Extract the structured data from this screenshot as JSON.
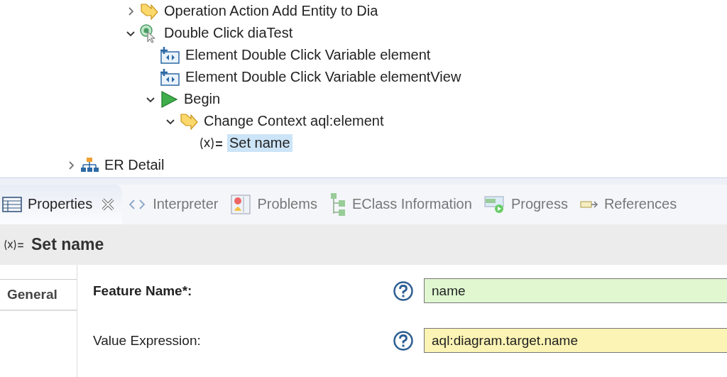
{
  "tree": {
    "items": [
      {
        "label": "Operation Action Add Entity to Dia",
        "kind": "operation",
        "expanded": false
      },
      {
        "label": "Double Click diaTest",
        "kind": "double-click",
        "expanded": true,
        "children": [
          {
            "label": "Element Double Click Variable element",
            "kind": "variable"
          },
          {
            "label": "Element Double Click Variable elementView",
            "kind": "variable"
          },
          {
            "label": "Begin",
            "kind": "begin",
            "expanded": true,
            "children": [
              {
                "label": "Change Context aql:element",
                "kind": "change-context",
                "expanded": true,
                "children": [
                  {
                    "label": "Set name",
                    "kind": "set",
                    "selected": true
                  }
                ]
              }
            ]
          }
        ]
      }
    ],
    "outer_items": [
      {
        "label": "ER Detail",
        "kind": "diagram",
        "expanded": false
      }
    ]
  },
  "tabs": [
    {
      "label": "Properties",
      "kind": "properties",
      "selected": true
    },
    {
      "label": "Interpreter",
      "kind": "interpreter",
      "selected": false
    },
    {
      "label": "Problems",
      "kind": "problems",
      "selected": false
    },
    {
      "label": "EClass Information",
      "kind": "eclass",
      "selected": false
    },
    {
      "label": "Progress",
      "kind": "progress",
      "selected": false
    },
    {
      "label": "References",
      "kind": "references",
      "selected": false
    }
  ],
  "properties": {
    "title": "Set name",
    "side_tabs": [
      {
        "label": "General",
        "selected": true
      }
    ],
    "fields": [
      {
        "label": "Feature Name*:",
        "required": true,
        "value": "name"
      },
      {
        "label": "Value Expression:",
        "required": false,
        "value": "aql:diagram.target.name"
      }
    ]
  }
}
